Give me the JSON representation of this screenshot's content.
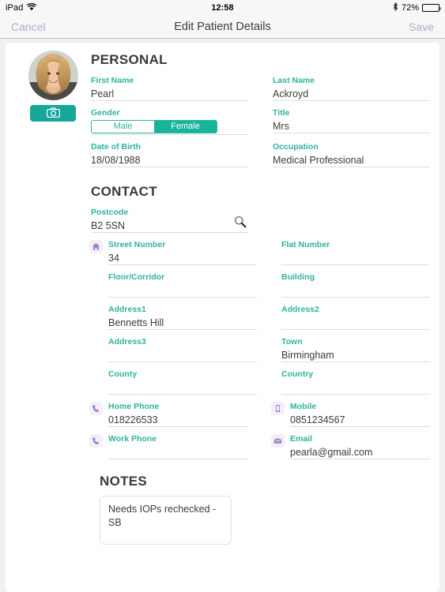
{
  "status_bar": {
    "device": "iPad",
    "wifi_icon": "wifi-icon",
    "time": "12:58",
    "bluetooth_icon": "bluetooth-icon",
    "battery_percent": "72%",
    "battery_level": 72
  },
  "nav_bar": {
    "cancel_label": "Cancel",
    "title": "Edit Patient Details",
    "save_label": "Save"
  },
  "avatar": {
    "name": "patient-avatar",
    "camera_icon": "camera-icon"
  },
  "personal": {
    "heading": "PERSONAL",
    "first_name": {
      "label": "First Name",
      "value": "Pearl"
    },
    "last_name": {
      "label": "Last Name",
      "value": "Ackroyd"
    },
    "gender": {
      "label": "Gender",
      "options": [
        "Male",
        "Female"
      ],
      "selected": "Female"
    },
    "title": {
      "label": "Title",
      "value": "Mrs"
    },
    "date_of_birth": {
      "label": "Date of Birth",
      "value": "18/08/1988"
    },
    "occupation": {
      "label": "Occupation",
      "value": "Medical Professional"
    }
  },
  "contact": {
    "heading": "CONTACT",
    "postcode": {
      "label": "Postcode",
      "value": "B2 5SN",
      "search_icon": "search-icon"
    },
    "street_number": {
      "label": "Street Number",
      "value": "34",
      "icon": "home-icon"
    },
    "flat_number": {
      "label": "Flat Number",
      "value": ""
    },
    "floor_corridor": {
      "label": "Floor/Corridor",
      "value": ""
    },
    "building": {
      "label": "Building",
      "value": ""
    },
    "address1": {
      "label": "Address1",
      "value": "Bennetts Hill"
    },
    "address2": {
      "label": "Address2",
      "value": ""
    },
    "address3": {
      "label": "Address3",
      "value": ""
    },
    "town": {
      "label": "Town",
      "value": "Birmingham"
    },
    "county": {
      "label": "County",
      "value": ""
    },
    "country": {
      "label": "Country",
      "value": ""
    },
    "home_phone": {
      "label": "Home Phone",
      "value": "018226533",
      "icon": "phone-icon"
    },
    "mobile": {
      "label": "Mobile",
      "value": "0851234567",
      "icon": "mobile-icon"
    },
    "work_phone": {
      "label": "Work Phone",
      "value": "",
      "icon": "phone-icon"
    },
    "email": {
      "label": "Email",
      "value": "pearla@gmail.com",
      "icon": "envelope-icon"
    }
  },
  "notes": {
    "heading": "NOTES",
    "value": "Needs IOPs rechecked - SB"
  },
  "colors": {
    "teal": "#2eb39d",
    "teal_selected": "#19b49c",
    "nav_link": "#b9a5c9",
    "icon_purple": "#9b7fc0",
    "page_background": "#efeff4"
  }
}
